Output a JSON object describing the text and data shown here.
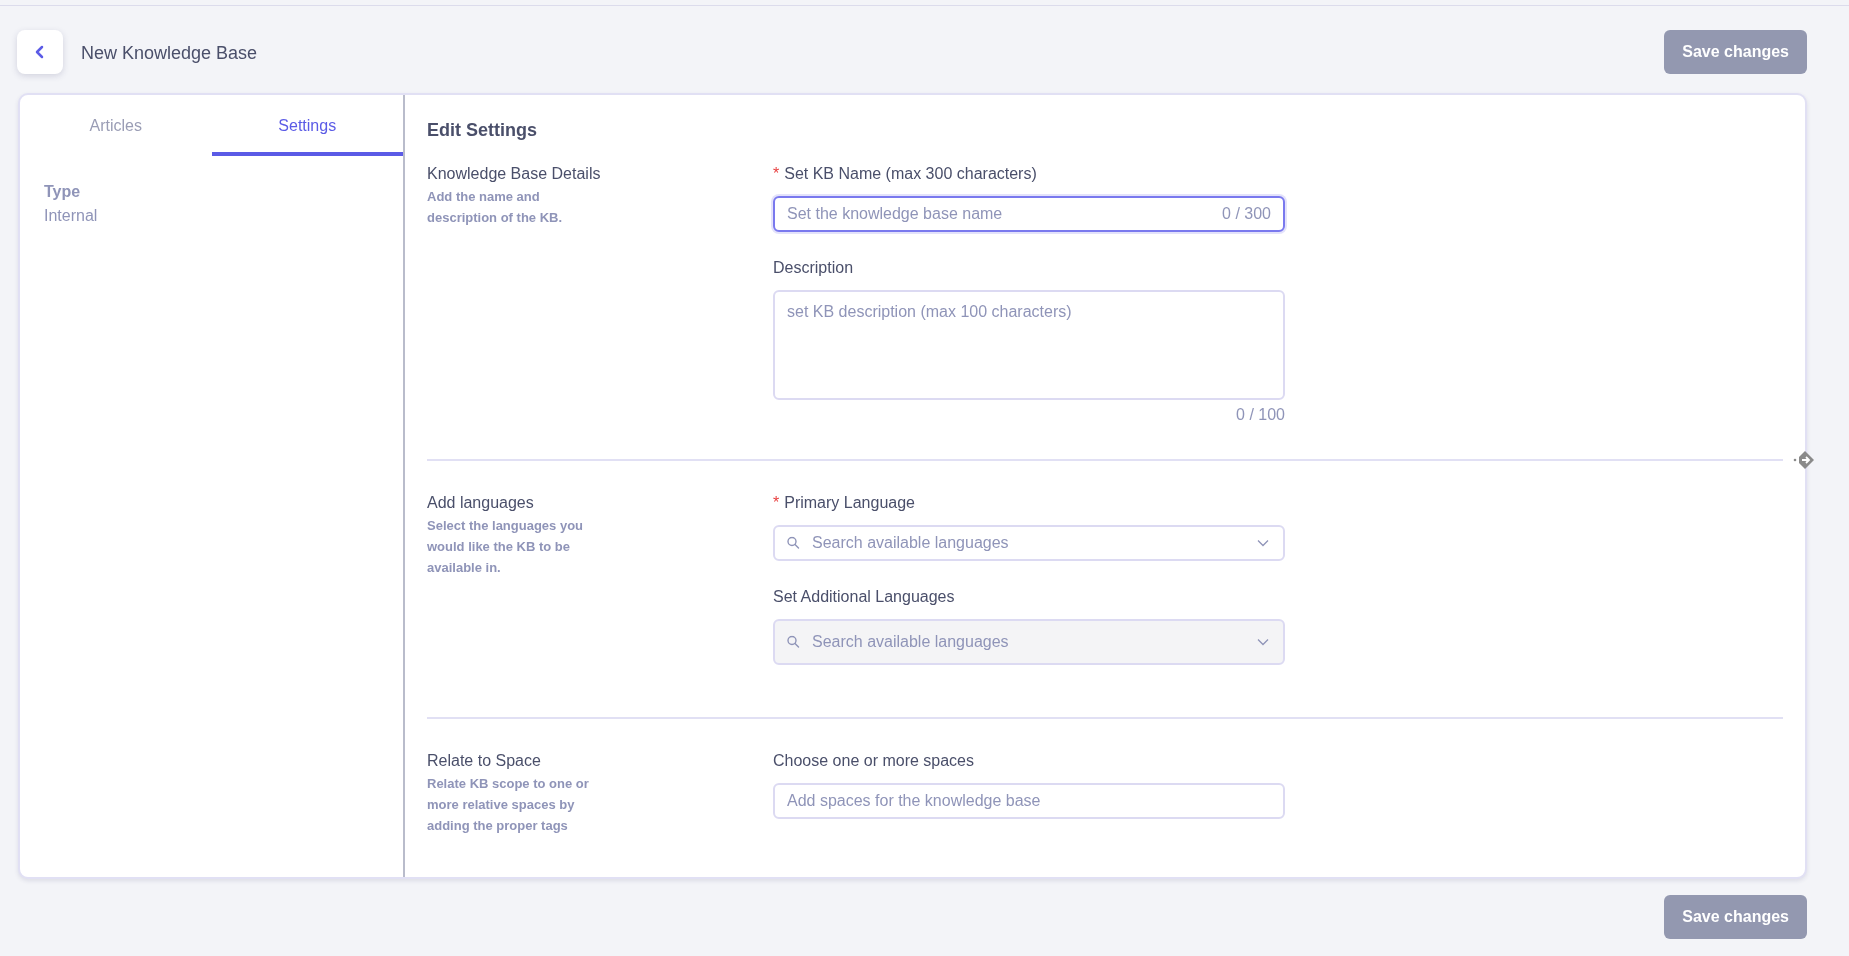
{
  "header": {
    "title": "New Knowledge Base",
    "save_button": "Save changes"
  },
  "tabs": [
    {
      "label": "Articles",
      "selected": false
    },
    {
      "label": "Settings",
      "selected": true
    }
  ],
  "sidebar": {
    "fields": [
      {
        "label": "Type",
        "value": "Internal"
      }
    ]
  },
  "main": {
    "title": "Edit Settings",
    "sections": [
      {
        "title": "Knowledge Base Details",
        "description": "Add the name and description of the KB.",
        "fields": [
          {
            "kind": "text",
            "label": "Set KB Name (max 300 characters)",
            "required_mark": "*",
            "placeholder": "Set the knowledge base name",
            "counter": "0 / 300",
            "focused": true,
            "disabled": false
          },
          {
            "kind": "textarea",
            "label": "Description",
            "placeholder": "set KB description (max 100 characters)",
            "counter": "0 / 100",
            "focused": false,
            "disabled": false
          }
        ]
      },
      {
        "title": "Add languages",
        "description": "Select the languages you would like the KB to be available in.",
        "fields": [
          {
            "kind": "select",
            "label": "Primary Language",
            "required_mark": "*",
            "placeholder": "Search available languages",
            "focused": false,
            "disabled": false
          },
          {
            "kind": "select",
            "label": "Set Additional Languages",
            "placeholder": "Search available languages",
            "focused": false,
            "disabled": true
          }
        ]
      },
      {
        "title": "Relate to Space",
        "description": "Relate KB scope to one or more relative spaces by adding the proper tags",
        "fields": [
          {
            "kind": "text",
            "label": "Choose one or more spaces",
            "placeholder": "Add spaces for the knowledge base",
            "focused": false,
            "disabled": false
          }
        ]
      }
    ]
  },
  "footer": {
    "save_button": "Save changes"
  }
}
